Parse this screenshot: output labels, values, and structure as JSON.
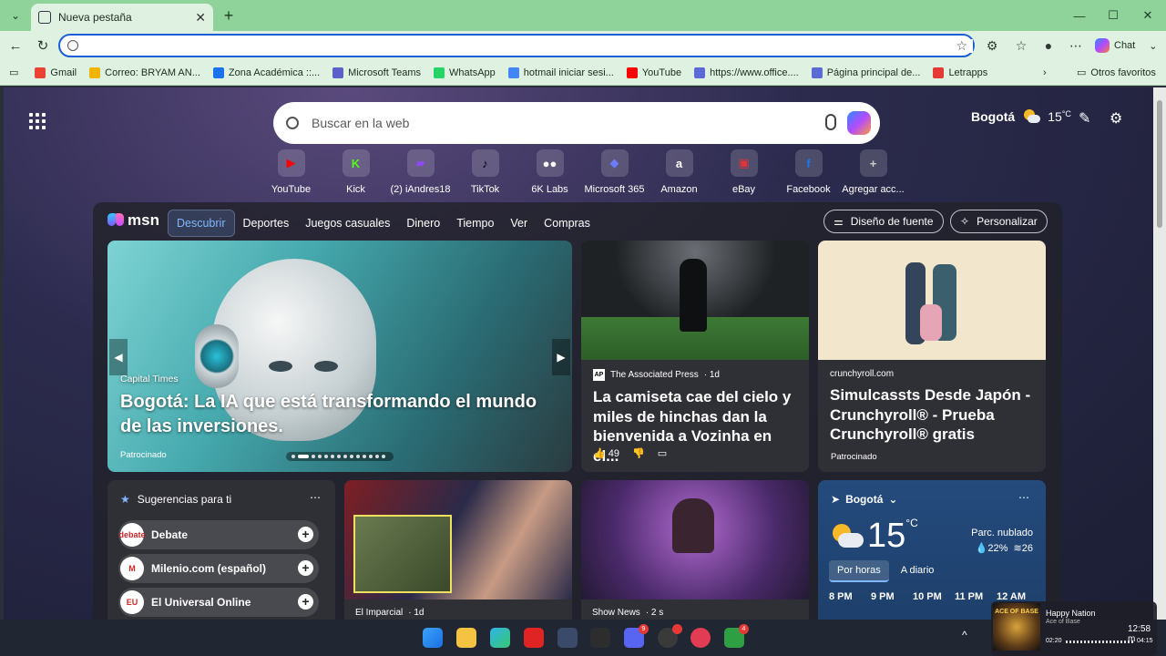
{
  "browser": {
    "tab_title": "Nueva pestaña",
    "address_value": "",
    "chat_label": "Chat"
  },
  "bookmarks": {
    "items": [
      {
        "label": "Gmail",
        "color": "#ea4335"
      },
      {
        "label": "Correo: BRYAM AN...",
        "color": "#f4b400"
      },
      {
        "label": "Zona Académica ::...",
        "color": "#1a73e8"
      },
      {
        "label": "Microsoft Teams",
        "color": "#5b5fc7"
      },
      {
        "label": "WhatsApp",
        "color": "#25d366"
      },
      {
        "label": "hotmail iniciar sesi...",
        "color": "#4285f4"
      },
      {
        "label": "YouTube",
        "color": "#ff0000"
      },
      {
        "label": "https://www.office....",
        "color": "#5b6bd6"
      },
      {
        "label": "Página principal de...",
        "color": "#5b6bd6"
      },
      {
        "label": "Letrapps",
        "color": "#e53935"
      }
    ],
    "others": "Otros favoritos"
  },
  "newtab": {
    "search_placeholder": "Buscar en la web",
    "location": "Bogotá",
    "temperature": "15",
    "temp_unit": "°C"
  },
  "quicklinks": [
    {
      "label": "YouTube",
      "glyph": "▶",
      "color": "#ff0000"
    },
    {
      "label": "Kick",
      "glyph": "K",
      "color": "#53fc18"
    },
    {
      "label": "(2) iAndres18",
      "glyph": "▰",
      "color": "#9146ff"
    },
    {
      "label": "TikTok",
      "glyph": "♪",
      "color": "#000000"
    },
    {
      "label": "6K Labs",
      "glyph": "●●",
      "color": "#ffffff"
    },
    {
      "label": "Microsoft 365",
      "glyph": "◆",
      "color": "#6a7cff"
    },
    {
      "label": "Amazon",
      "glyph": "a",
      "color": "#ffffff"
    },
    {
      "label": "eBay",
      "glyph": "▣",
      "color": "#e53238"
    },
    {
      "label": "Facebook",
      "glyph": "f",
      "color": "#1877f2"
    },
    {
      "label": "Agregar acc...",
      "glyph": "+",
      "color": "#cccccc"
    }
  ],
  "msn": {
    "logo_text": "msn",
    "tabs": [
      "Descubrir",
      "Deportes",
      "Juegos casuales",
      "Dinero",
      "Tiempo",
      "Ver",
      "Compras"
    ],
    "active_tab": "Descubrir",
    "font_design_label": "Diseño de fuente",
    "personalize_label": "Personalizar"
  },
  "hero": {
    "source": "Capital Times",
    "title": "Bogotá: La IA que está transformando el mundo de las inversiones.",
    "sponsor": "Patrocinado"
  },
  "news": [
    {
      "source": "The Associated Press",
      "age": "· 1d",
      "title": "La camiseta cae del cielo y miles de hinchas dan la bienvenida a Vozinha en el...",
      "likes": "49"
    },
    {
      "source": "crunchyroll.com",
      "title": "Simulcassts Desde Japón - Crunchyroll® - Prueba Crunchyroll® gratis",
      "sponsor": "Patrocinado"
    }
  ],
  "suggestions": {
    "title": "Sugerencias para ti",
    "items": [
      {
        "label": "Debate",
        "logo": "debate"
      },
      {
        "label": "Milenio.com (español)",
        "logo": "M"
      },
      {
        "label": "El Universal Online",
        "logo": "EU"
      }
    ]
  },
  "small_cards": [
    {
      "source": "El Imparcial",
      "age": "· 1d"
    },
    {
      "source": "Show News",
      "age": "· 2 s"
    }
  ],
  "weather_card": {
    "location": "Bogotá",
    "temperature": "15",
    "unit": "°C",
    "condition": "Parc. nublado",
    "humidity": "22%",
    "wind": "26",
    "tabs": [
      "Por horas",
      "A diario"
    ],
    "hours": [
      "8 PM",
      "9 PM",
      "10 PM",
      "11 PM",
      "12 AM"
    ]
  },
  "media": {
    "art_text": "ACE OF BASE",
    "song": "Happy Nation",
    "artist": "Ace of Base",
    "elapsed": "02:20",
    "total": "04:15",
    "clock": "12:58 m"
  }
}
